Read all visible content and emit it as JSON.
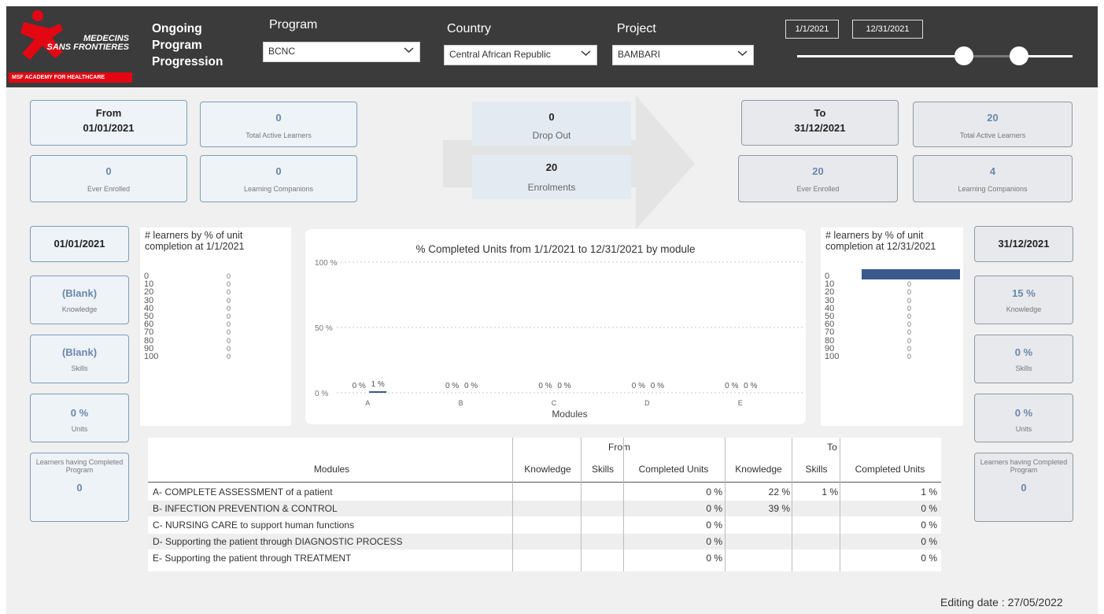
{
  "header": {
    "logo_text_line1": "MEDECINS",
    "logo_text_line2": "SANS FRONTIERES",
    "logo_band": "MSF ACADEMY FOR HEALTHCARE",
    "title_line1": "Ongoing",
    "title_line2": "Program",
    "title_line3": "Progression",
    "program_label": "Program",
    "program_value": "BCNC",
    "country_label": "Country",
    "country_value": "Central African Republic",
    "project_label": "Project",
    "project_value": "BAMBARI",
    "date_start": "1/1/2021",
    "date_end": "12/31/2021"
  },
  "from_section": {
    "heading": "From",
    "date": "01/01/2021",
    "total_active_value": "0",
    "total_active_label": "Total Active Learners",
    "ever_enrolled_value": "0",
    "ever_enrolled_label": "Ever Enrolled",
    "companions_value": "0",
    "companions_label": "Learning Companions"
  },
  "middle": {
    "dropout_value": "0",
    "dropout_label": "Drop Out",
    "enrolments_value": "20",
    "enrolments_label": "Enrolments"
  },
  "to_section": {
    "heading": "To",
    "date": "31/12/2021",
    "total_active_value": "20",
    "total_active_label": "Total Active Learners",
    "ever_enrolled_value": "20",
    "ever_enrolled_label": "Ever Enrolled",
    "companions_value": "4",
    "companions_label": "Learning Companions"
  },
  "left_kpis": {
    "date": "01/01/2021",
    "knowledge_value": "(Blank)",
    "knowledge_label": "Knowledge",
    "skills_value": "(Blank)",
    "skills_label": "Skills",
    "units_value": "0 %",
    "units_label": "Units",
    "completed_label": "Learners having Completed Program",
    "completed_value": "0"
  },
  "right_kpis": {
    "date": "31/12/2021",
    "knowledge_value": "15 %",
    "knowledge_label": "Knowledge",
    "skills_value": "0 %",
    "skills_label": "Skills",
    "units_value": "0 %",
    "units_label": "Units",
    "completed_label": "Learners having Completed Program",
    "completed_value": "0"
  },
  "hist_left": {
    "title": "# learners by % of unit completion at 1/1/2021",
    "rows": [
      {
        "k": "0",
        "c": "0"
      },
      {
        "k": "10",
        "c": "0"
      },
      {
        "k": "20",
        "c": "0"
      },
      {
        "k": "30",
        "c": "0"
      },
      {
        "k": "40",
        "c": "0"
      },
      {
        "k": "50",
        "c": "0"
      },
      {
        "k": "60",
        "c": "0"
      },
      {
        "k": "70",
        "c": "0"
      },
      {
        "k": "80",
        "c": "0"
      },
      {
        "k": "90",
        "c": "0"
      },
      {
        "k": "100",
        "c": "0"
      }
    ]
  },
  "hist_right": {
    "title": "# learners by % of unit completion at 12/31/2021",
    "rows": [
      {
        "k": "0",
        "c": ""
      },
      {
        "k": "10",
        "c": "0"
      },
      {
        "k": "20",
        "c": "0"
      },
      {
        "k": "30",
        "c": "0"
      },
      {
        "k": "40",
        "c": "0"
      },
      {
        "k": "50",
        "c": "0"
      },
      {
        "k": "60",
        "c": "0"
      },
      {
        "k": "70",
        "c": "0"
      },
      {
        "k": "80",
        "c": "0"
      },
      {
        "k": "90",
        "c": "0"
      },
      {
        "k": "100",
        "c": "0"
      }
    ],
    "bar_fraction_row0": 1.0
  },
  "chart_data": {
    "type": "bar",
    "title": "% Completed Units from 1/1/2021 to 12/31/2021 by module",
    "xlabel": "Modules",
    "ylabel": "",
    "ylim": [
      0,
      100
    ],
    "y_ticks": [
      "100 %",
      "50 %",
      "0 %"
    ],
    "categories": [
      "A",
      "B",
      "C",
      "D",
      "E"
    ],
    "series": [
      {
        "values": [
          0,
          0,
          0,
          0,
          0
        ],
        "labels": [
          "0 %",
          "0 %",
          "0 %",
          "0 %",
          "0 %"
        ],
        "color": "#3a5a8c"
      },
      {
        "values": [
          1,
          0,
          0,
          0,
          0
        ],
        "labels": [
          "1 %",
          "0 %",
          "0 %",
          "0 %",
          "0 %"
        ],
        "color": "#3a5a8c"
      }
    ]
  },
  "table": {
    "group_from": "From",
    "group_to": "To",
    "headers": [
      "Modules",
      "Knowledge",
      "Skills",
      "Completed Units",
      "Knowledge",
      "Skills",
      "Completed Units"
    ],
    "rows": [
      [
        "A- COMPLETE ASSESSMENT of a patient",
        "",
        "",
        "0 %",
        "22 %",
        "1 %",
        "1 %"
      ],
      [
        "B- INFECTION PREVENTION & CONTROL",
        "",
        "",
        "0 %",
        "39 %",
        "",
        "0 %"
      ],
      [
        "C- NURSING CARE to support human functions",
        "",
        "",
        "0 %",
        "",
        "",
        "0 %"
      ],
      [
        "D- Supporting the patient through DIAGNOSTIC PROCESS",
        "",
        "",
        "0 %",
        "",
        "",
        "0 %"
      ],
      [
        "E- Supporting the patient through TREATMENT",
        "",
        "",
        "0 %",
        "",
        "",
        "0 %"
      ]
    ]
  },
  "footer": {
    "editing_date": "Editing date : 27/05/2022"
  },
  "colors": {
    "header_bg": "#3b3b3b",
    "msf_red": "#e30613",
    "card_value_blue": "#6a87ae",
    "bar_blue": "#3a5a8c"
  }
}
